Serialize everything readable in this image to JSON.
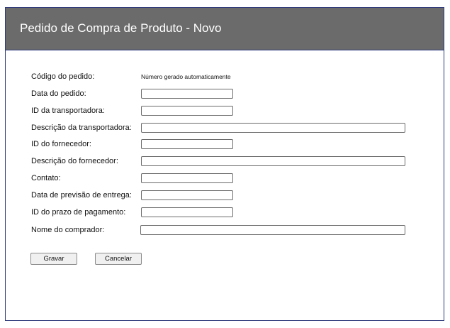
{
  "window": {
    "title": "Pedido de Compra de Produto - Novo"
  },
  "form": {
    "order_code": {
      "label": "Código do pedido:",
      "note": "Número gerado automaticamente"
    },
    "fields": [
      {
        "label": "Data do pedido:",
        "value": ""
      },
      {
        "label": "ID da transportadora:",
        "value": ""
      },
      {
        "label": "Descrição da transportadora:",
        "value": ""
      },
      {
        "label": "ID do fornecedor:",
        "value": ""
      },
      {
        "label": "Descrição do fornecedor:",
        "value": ""
      },
      {
        "label": "Contato:",
        "value": ""
      },
      {
        "label": "Data de previsão de entrega:",
        "value": ""
      },
      {
        "label": "ID do prazo de pagamento:",
        "value": ""
      },
      {
        "label": "Nome do comprador:",
        "value": ""
      }
    ]
  },
  "buttons": {
    "save_label": "Gravar",
    "cancel_label": "Cancelar"
  },
  "colors": {
    "titlebar": "#6b6b6b",
    "border": "#2e3a7a"
  }
}
